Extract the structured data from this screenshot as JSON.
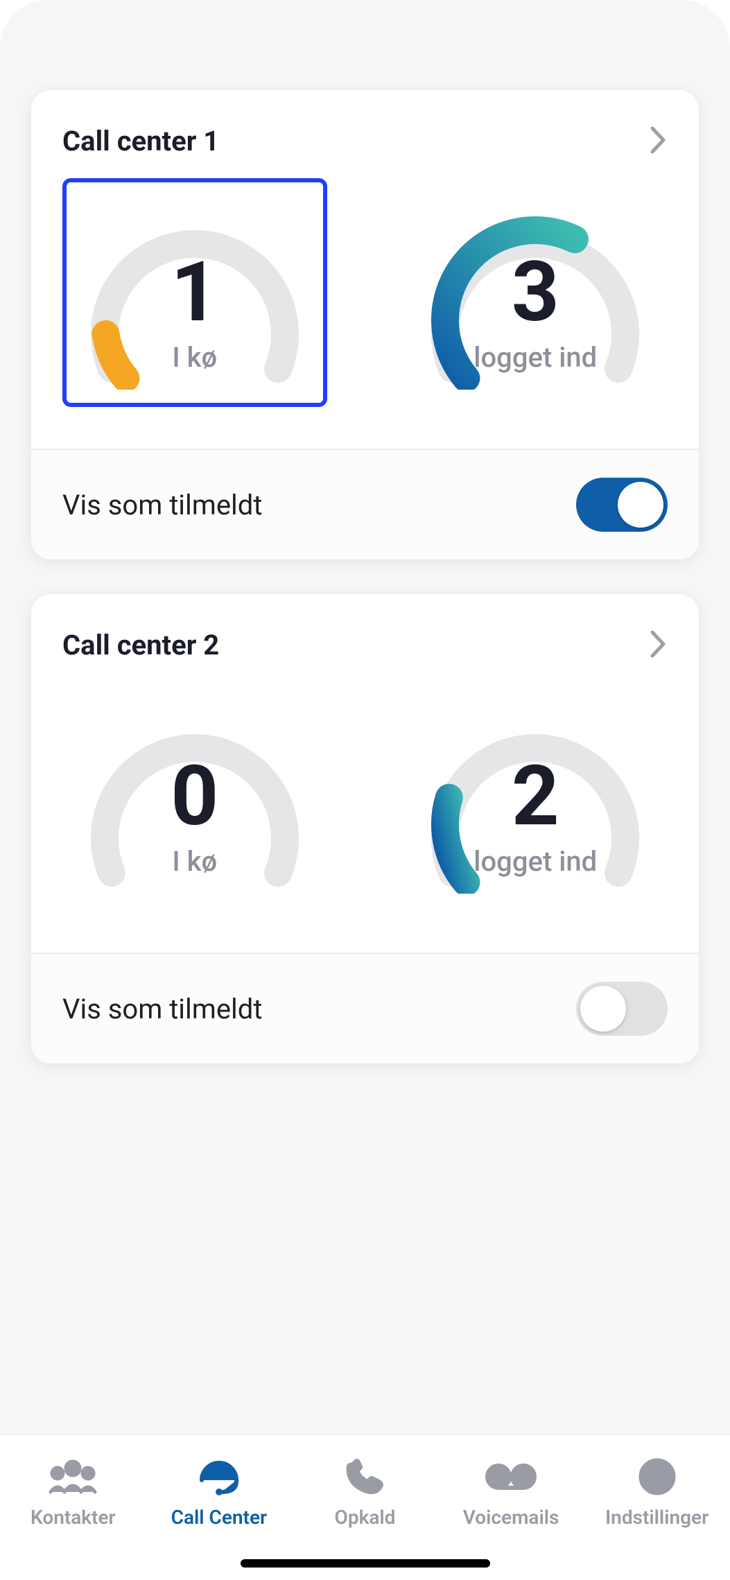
{
  "chart_data": [
    {
      "type": "gauge",
      "title": "Call center 1 — I kø",
      "value": 1,
      "label": "I kø",
      "fraction": 0.12
    },
    {
      "type": "gauge",
      "title": "Call center 1 — logget ind",
      "value": 3,
      "label": "logget ind",
      "fraction": 0.6
    },
    {
      "type": "gauge",
      "title": "Call center 2 — I kø",
      "value": 0,
      "label": "I kø",
      "fraction": 0.0
    },
    {
      "type": "gauge",
      "title": "Call center 2 — logget ind",
      "value": 2,
      "label": "logget ind",
      "fraction": 0.22
    }
  ],
  "cards": [
    {
      "title": "Call center 1",
      "gauges": [
        {
          "value": "1",
          "label": "I kø",
          "selected": true,
          "arc_fraction": 0.12,
          "arc_color_start": "#f5a623",
          "arc_color_end": "#f5a623"
        },
        {
          "value": "3",
          "label": "logget ind",
          "selected": false,
          "arc_fraction": 0.6,
          "arc_color_start": "#0f5fa8",
          "arc_color_end": "#3fbdb1"
        }
      ],
      "footer_label": "Vis som tilmeldt",
      "toggle_on": true
    },
    {
      "title": "Call center 2",
      "gauges": [
        {
          "value": "0",
          "label": "I kø",
          "selected": false,
          "arc_fraction": 0.0,
          "arc_color_start": "#f5a623",
          "arc_color_end": "#f5a623"
        },
        {
          "value": "2",
          "label": "logget ind",
          "selected": false,
          "arc_fraction": 0.22,
          "arc_color_start": "#0f5fa8",
          "arc_color_end": "#3fbdb1"
        }
      ],
      "footer_label": "Vis som tilmeldt",
      "toggle_on": false
    }
  ],
  "tabs": [
    {
      "label": "Kontakter",
      "icon": "contacts",
      "active": false
    },
    {
      "label": "Call Center",
      "icon": "callcenter",
      "active": true
    },
    {
      "label": "Opkald",
      "icon": "phone",
      "active": false
    },
    {
      "label": "Voicemails",
      "icon": "voicemail",
      "active": false
    },
    {
      "label": "Indstillinger",
      "icon": "settings",
      "active": false
    }
  ]
}
